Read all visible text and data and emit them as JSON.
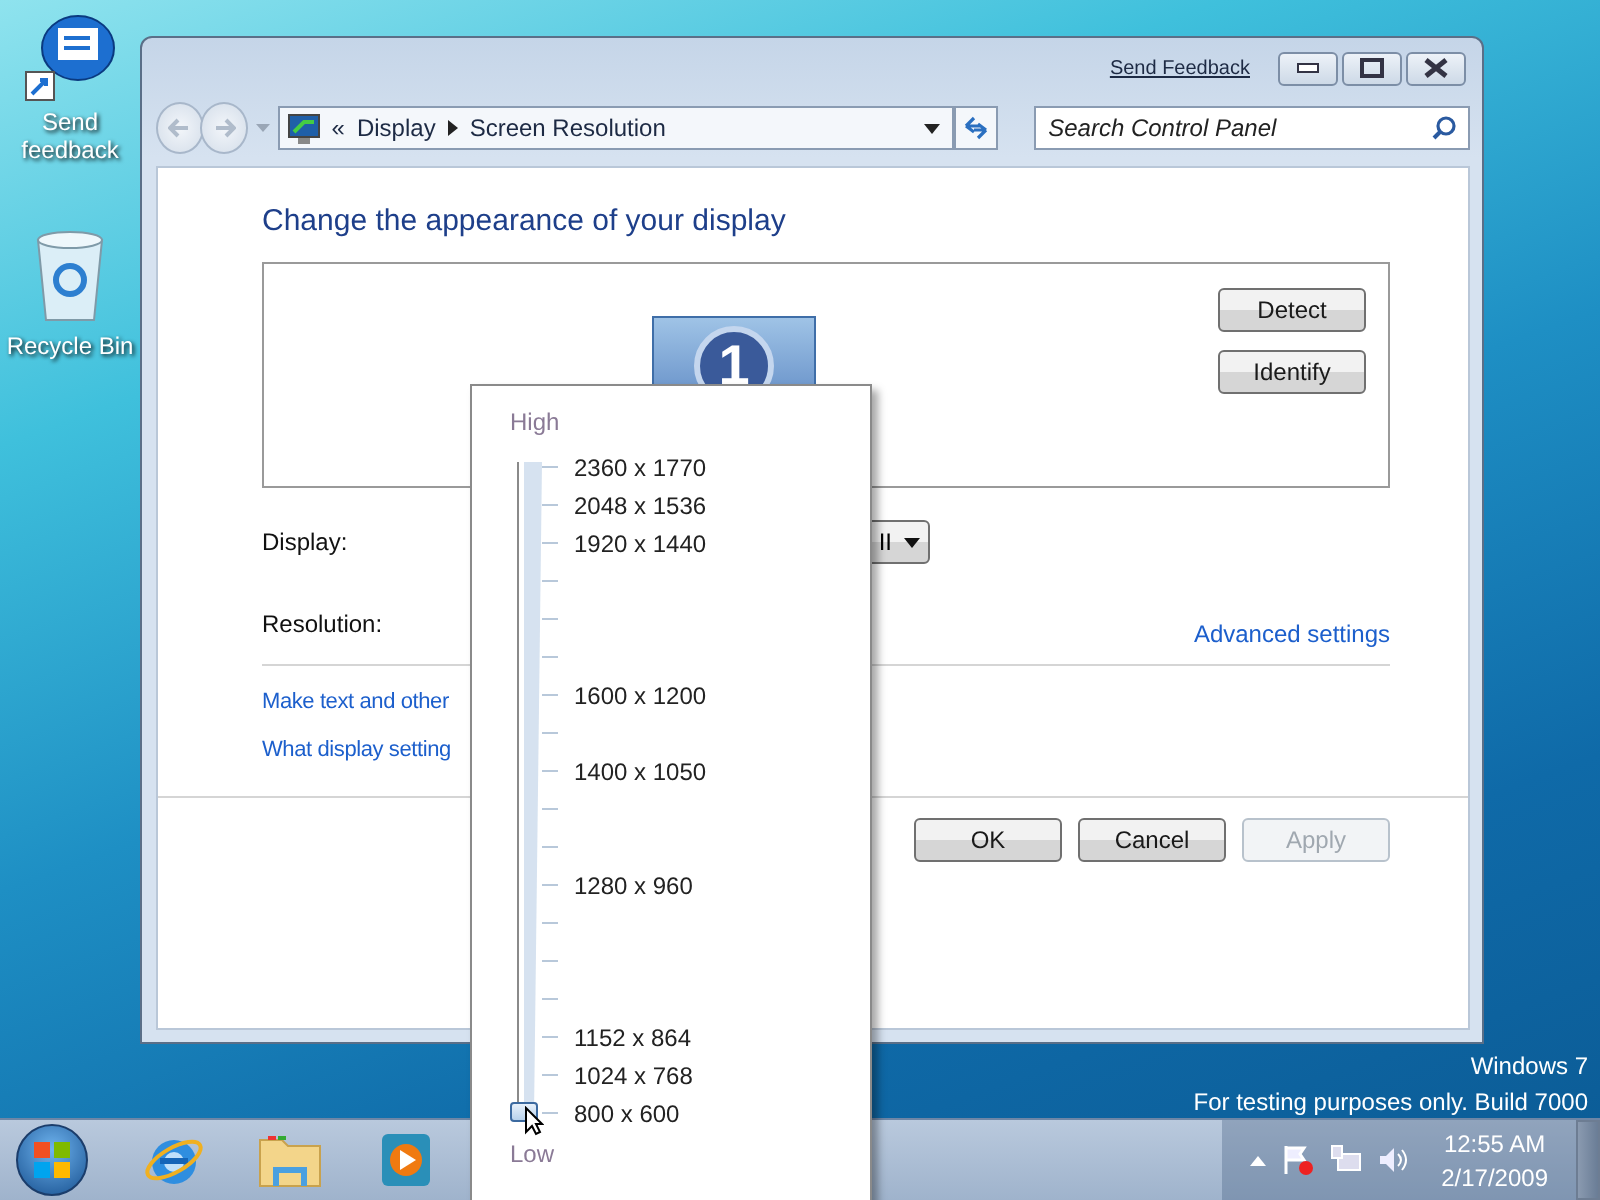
{
  "desktop_icons": [
    {
      "label": "Send feedback",
      "kind": "feedback"
    },
    {
      "label": "Recycle Bin",
      "kind": "recycle"
    }
  ],
  "window": {
    "send_feedback": "Send Feedback",
    "overflow": "«",
    "breadcrumb": [
      "Display",
      "Screen Resolution"
    ],
    "search": {
      "placeholder": "Search Control Panel"
    },
    "heading": "Change the appearance of your display",
    "detect": "Detect",
    "identify": "Identify",
    "monitor_number": "1",
    "display_label": "Display:",
    "display_value": "II",
    "resolution_label": "Resolution:",
    "advanced_link": "Advanced settings",
    "links": [
      "Make text and other",
      "What display setting"
    ],
    "buttons": [
      {
        "label": "OK",
        "disabled": false
      },
      {
        "label": "Cancel",
        "disabled": false
      },
      {
        "label": "Apply",
        "disabled": true
      }
    ]
  },
  "resolution_slider": {
    "high": "High",
    "low": "Low",
    "level": 0,
    "steps": [
      {
        "kind": "labeled",
        "label": "2360 x 1770"
      },
      {
        "kind": "labeled",
        "label": "2048 x 1536"
      },
      {
        "kind": "labeled",
        "label": "1920 x 1440"
      },
      {
        "kind": "tick"
      },
      {
        "kind": "tick"
      },
      {
        "kind": "tick"
      },
      {
        "kind": "labeled",
        "label": "1600 x 1200"
      },
      {
        "kind": "tick"
      },
      {
        "kind": "labeled",
        "label": "1400 x 1050"
      },
      {
        "kind": "tick"
      },
      {
        "kind": "tick"
      },
      {
        "kind": "labeled",
        "label": "1280 x 960"
      },
      {
        "kind": "tick"
      },
      {
        "kind": "tick"
      },
      {
        "kind": "tick"
      },
      {
        "kind": "labeled",
        "label": "1152 x 864"
      },
      {
        "kind": "labeled",
        "label": "1024 x 768"
      },
      {
        "kind": "labeled",
        "label": "800 x 600"
      }
    ]
  },
  "desktop_text": [
    "Windows 7",
    "For testing purposes only. Build 7000"
  ],
  "taskbar": {
    "pinned": [
      {
        "kind": "browser"
      },
      {
        "kind": "folder"
      },
      {
        "kind": "media"
      }
    ],
    "clock": {
      "time": "12:55 AM",
      "date": "2/17/2009"
    }
  }
}
